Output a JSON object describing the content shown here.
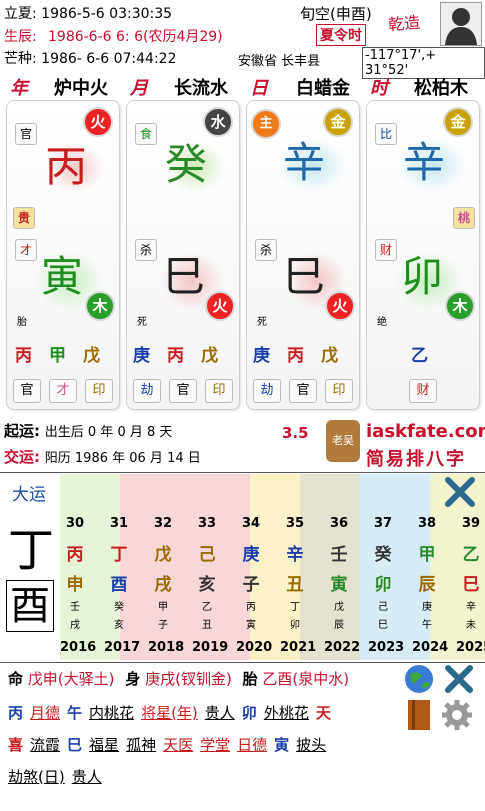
{
  "header": {
    "lixia": "立夏: 1986-5-6 03:30:35",
    "xunkong": "旬空(申酉)",
    "qianzao": "乾造",
    "shengchen_label": "生辰:",
    "shengchen_value": "1986-6-6  6: 6(农历4月29)",
    "xialingshi": "夏令时",
    "mangzhong": "芒种: 1986- 6-6 07:44:22",
    "location": "安徽省 长丰县",
    "coords": "-117°17',+ 31°52'"
  },
  "pillars": [
    {
      "pos": "年",
      "nayin": "炉中火",
      "tg_shishen": "官",
      "stem": "丙",
      "stem_elem": "火",
      "extra_tag": "贵",
      "dz_shishen": "才",
      "branch": "寅",
      "branch_elem": "木",
      "stage": "胎",
      "hidden": [
        "丙",
        "甲",
        "戊"
      ],
      "hidden_shishen": [
        "官",
        "才",
        "印"
      ]
    },
    {
      "pos": "月",
      "nayin": "长流水",
      "tg_shishen": "食",
      "stem": "癸",
      "stem_elem": "水",
      "extra_tag": "",
      "dz_shishen": "杀",
      "branch": "巳",
      "branch_elem": "火",
      "stage": "死",
      "hidden": [
        "庚",
        "丙",
        "戊"
      ],
      "hidden_shishen": [
        "劫",
        "官",
        "印"
      ]
    },
    {
      "pos": "日",
      "nayin": "白蜡金",
      "tg_shishen": "主",
      "stem": "辛",
      "stem_elem": "金",
      "extra_tag": "",
      "dz_shishen": "杀",
      "branch": "巳",
      "branch_elem": "火",
      "stage": "死",
      "hidden": [
        "庚",
        "丙",
        "戊"
      ],
      "hidden_shishen": [
        "劫",
        "官",
        "印"
      ]
    },
    {
      "pos": "时",
      "nayin": "松柏木",
      "tg_shishen": "比",
      "stem": "辛",
      "stem_elem": "金",
      "extra_tag": "桃",
      "dz_shishen": "财",
      "branch": "卯",
      "branch_elem": "木",
      "stage": "绝",
      "hidden": [
        "",
        "乙",
        ""
      ],
      "hidden_shishen": [
        "",
        "财",
        ""
      ]
    }
  ],
  "qiyun": {
    "label": "起运:",
    "value": "出生后 0 年 0 月 8 天",
    "jiaoyun_label": "交运:",
    "jiaoyun_value": "阳历 1986 年 06 月 14 日",
    "score": "3.5",
    "site": "iaskfate.com",
    "slogan": "简易排八字",
    "seal": "老吴"
  },
  "dayun": {
    "title": "大运",
    "current_stem": "丁",
    "current_branch": "酉",
    "ages": [
      "30",
      "31",
      "32",
      "33",
      "34",
      "35",
      "36",
      "37",
      "38",
      "39"
    ],
    "stems": [
      "丙",
      "丁",
      "戊",
      "己",
      "庚",
      "辛",
      "壬",
      "癸",
      "甲",
      "乙"
    ],
    "branches": [
      "申",
      "酉",
      "戌",
      "亥",
      "子",
      "丑",
      "寅",
      "卯",
      "辰",
      "巳"
    ],
    "hidden_top": [
      "壬",
      "癸",
      "甲",
      "乙",
      "丙",
      "丁",
      "戊",
      "己",
      "庚",
      "辛"
    ],
    "hidden_bot": [
      "戌",
      "亥",
      "子",
      "丑",
      "寅",
      "卯",
      "辰",
      "巳",
      "午",
      "未"
    ],
    "years": [
      "2016",
      "2017",
      "2018",
      "2019",
      "2020",
      "2021",
      "2022",
      "2023",
      "2024",
      "2025"
    ]
  },
  "bottom": {
    "ming_label": "命",
    "ming_value": "戊申(大驿土)",
    "shen_label": "身",
    "shen_value": "庚戌(钗钏金)",
    "tai_label": "胎",
    "tai_value": "乙酉(泉中水)",
    "row2": [
      {
        "t": "丙",
        "k": "blue"
      },
      {
        "t": "月德",
        "k": "red"
      },
      {
        "t": "午",
        "k": "blue"
      },
      {
        "t": "内桃花",
        "k": "black"
      },
      {
        "t": "将星(年)",
        "k": "red"
      },
      {
        "t": "贵人",
        "k": "black"
      },
      {
        "t": "卯",
        "k": "blue"
      },
      {
        "t": "外桃花",
        "k": "black"
      },
      {
        "t": "天",
        "k": "red"
      }
    ],
    "row3": [
      {
        "t": "喜",
        "k": "red"
      },
      {
        "t": "流霞",
        "k": "black"
      },
      {
        "t": "巳",
        "k": "blue"
      },
      {
        "t": "福星",
        "k": "black"
      },
      {
        "t": "孤神",
        "k": "black"
      },
      {
        "t": "天医",
        "k": "red"
      },
      {
        "t": "学堂",
        "k": "red"
      },
      {
        "t": "日德",
        "k": "red"
      },
      {
        "t": "寅",
        "k": "blue"
      },
      {
        "t": "披头",
        "k": "black"
      }
    ],
    "row4": [
      {
        "t": "劫煞(日)",
        "k": "black"
      },
      {
        "t": "贵人",
        "k": "black"
      }
    ]
  }
}
